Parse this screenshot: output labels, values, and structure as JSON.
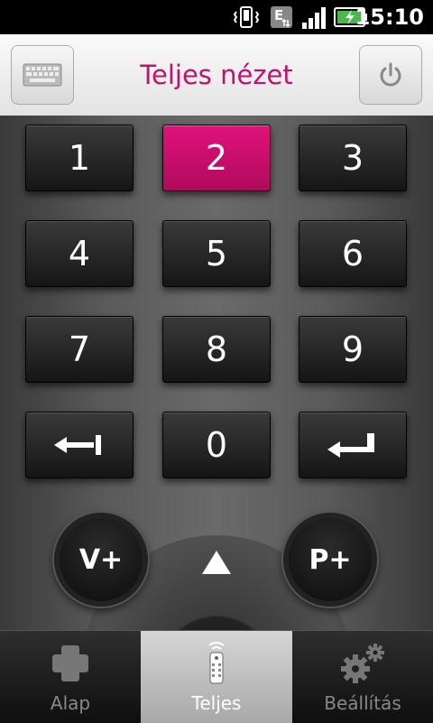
{
  "status_bar": {
    "time": "15:10",
    "network_label": "E",
    "icons": [
      "vibrate-icon",
      "edge-network-icon",
      "signal-icon",
      "battery-charging-icon"
    ]
  },
  "header": {
    "title": "Teljes nézet",
    "left_button_icon": "keyboard-icon",
    "right_button_icon": "power-icon"
  },
  "keypad": {
    "keys": [
      "1",
      "2",
      "3",
      "4",
      "5",
      "6",
      "7",
      "8",
      "9",
      "",
      "0",
      ""
    ],
    "active_key": "2",
    "back_icon": "back-arrow-icon",
    "enter_icon": "enter-arrow-icon"
  },
  "controls": {
    "volume_label": "V+",
    "channel_label": "P+",
    "up_icon": "up-arrow-icon"
  },
  "tabs": [
    {
      "label": "Alap",
      "icon": "dpad-icon",
      "selected": false
    },
    {
      "label": "Teljes",
      "icon": "remote-icon",
      "selected": true
    },
    {
      "label": "Beállítás",
      "icon": "gears-icon",
      "selected": false
    }
  ],
  "colors": {
    "accent": "#c2126b",
    "active_key": "#d0106d"
  }
}
